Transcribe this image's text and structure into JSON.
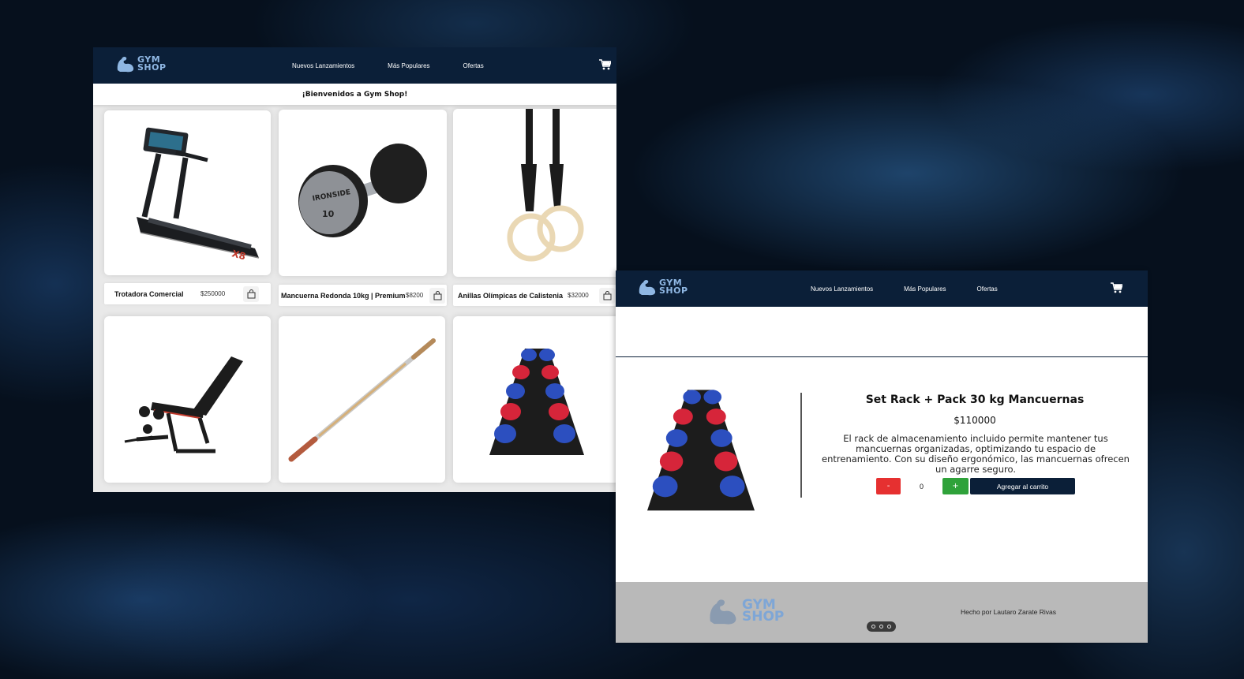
{
  "brand": {
    "logo_line1": "GYM",
    "logo_line2": "SHOP",
    "primary_color": "#0b1f38",
    "logo_color": "#8fb7e3"
  },
  "nav": {
    "links": [
      "Nuevos Lanzamientos",
      "Más Populares",
      "Ofertas"
    ],
    "cart_icon": "shopping-cart-icon"
  },
  "home": {
    "welcome": "¡Bienvenidos a Gym Shop!",
    "products": [
      {
        "name": "Trotadora Comercial",
        "price": "$250000",
        "image": "treadmill"
      },
      {
        "name": "Mancuerna Redonda 10kg | Premium",
        "price": "$8200",
        "image": "dumbbell"
      },
      {
        "name": "Anillas Olímpicas de Calistenia",
        "price": "$32000",
        "image": "gym-rings"
      },
      {
        "name": "",
        "price": "",
        "image": "adjustable-bench"
      },
      {
        "name": "",
        "price": "",
        "image": "olympic-barbell"
      },
      {
        "name": "",
        "price": "",
        "image": "dumbbell-rack"
      }
    ]
  },
  "detail": {
    "title": "Set Rack + Pack 30 kg Mancuernas",
    "price": "$110000",
    "description": "El rack de almacenamiento incluido permite mantener tus mancuernas organizadas, optimizando tu espacio de entrenamiento. Con su diseño ergonómico, las mancuernas ofrecen un agarre seguro.",
    "minus_label": "-",
    "quantity": "0",
    "plus_label": "+",
    "add_to_cart_label": "Agregar al carrito",
    "minus_color": "#e63030",
    "plus_color": "#2fa23a"
  },
  "footer": {
    "credit": "Hecho por Lautaro Zarate Rivas"
  }
}
